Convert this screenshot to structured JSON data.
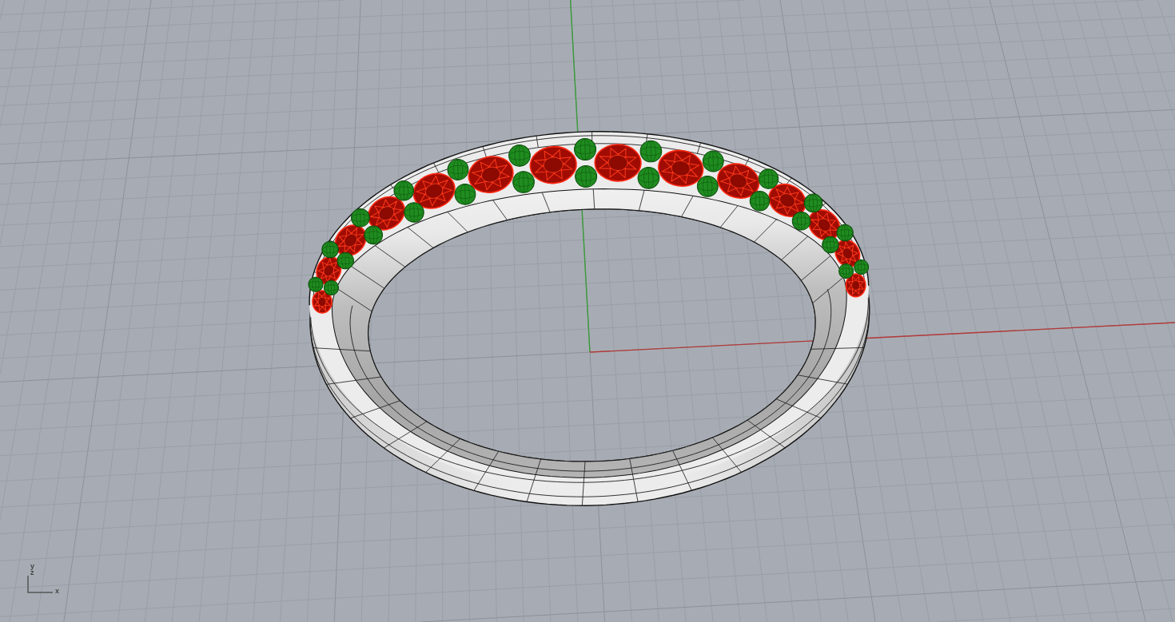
{
  "viewport": {
    "axis_widget": {
      "labels": [
        {
          "kind": "vertical",
          "text": "y"
        },
        {
          "kind": "vertical",
          "text": "z"
        },
        {
          "kind": "horizontal",
          "text": "x"
        }
      ]
    }
  }
}
